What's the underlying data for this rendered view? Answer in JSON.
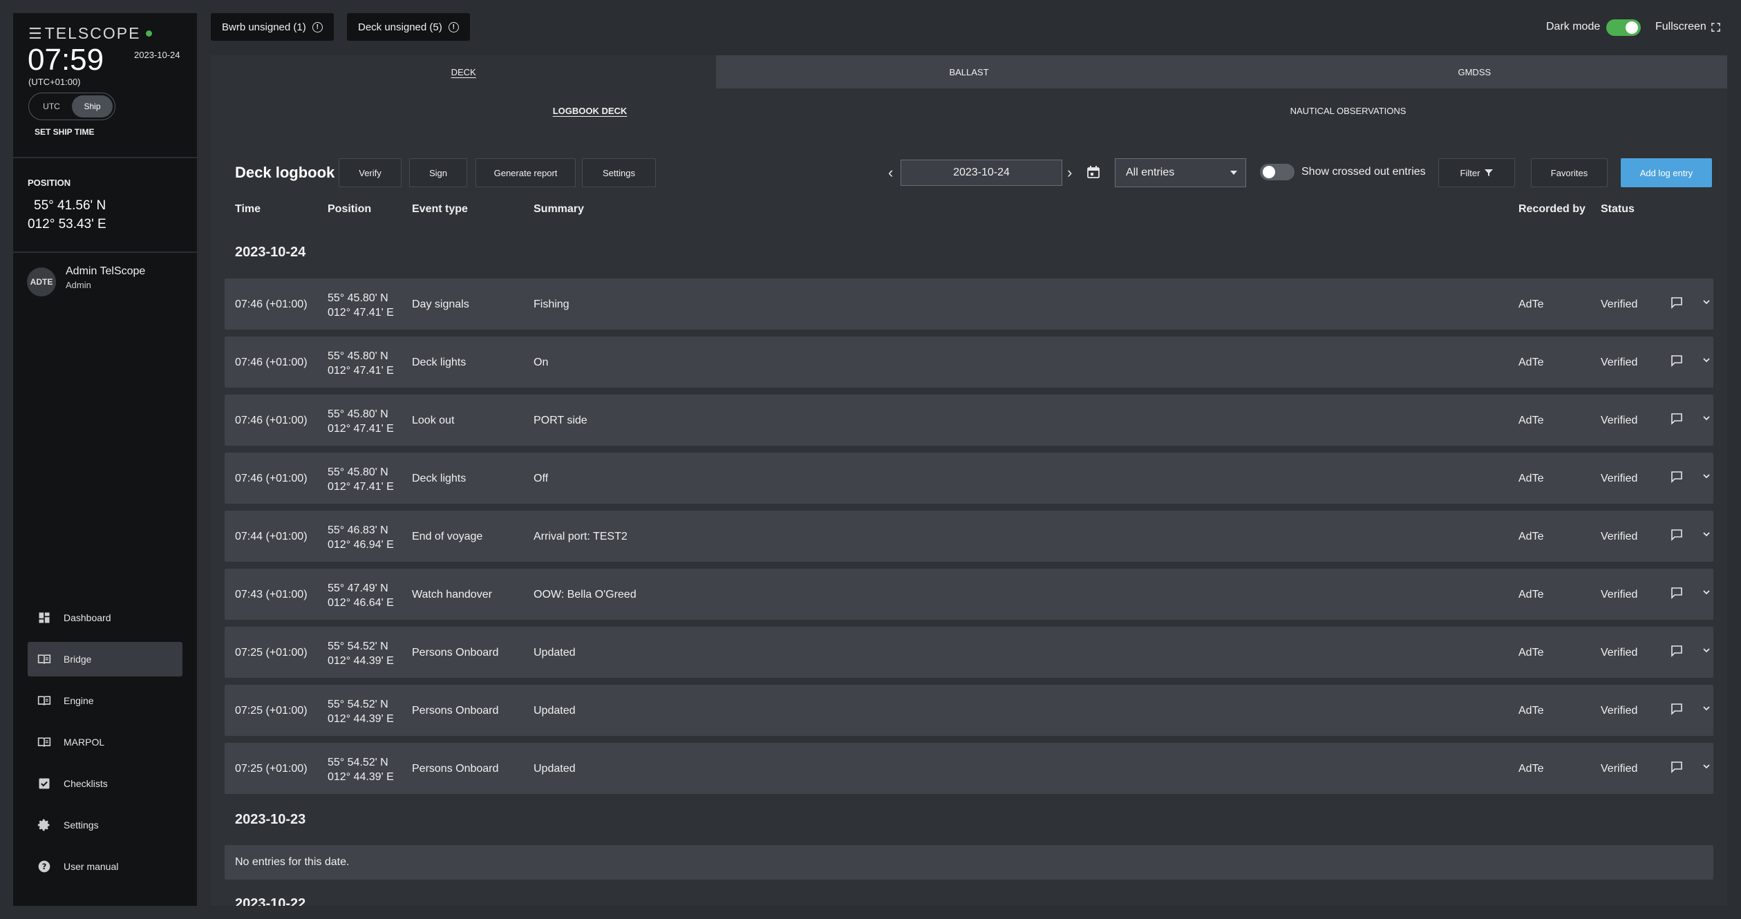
{
  "sidebar": {
    "logo_text": "TELSCOPE",
    "clock_time": "07:59",
    "clock_date": "2023-10-24",
    "timezone": "(UTC+01:00)",
    "time_modes": [
      "UTC",
      "Ship"
    ],
    "active_time_mode": "Ship",
    "set_ship_time_label": "SET SHIP TIME",
    "position_label": "POSITION",
    "position_lat": "55° 41.56' N",
    "position_lon": "012° 53.43' E",
    "user_initials": "ADTE",
    "user_name": "Admin TelScope",
    "user_role": "Admin",
    "nav": [
      {
        "label": "Dashboard",
        "icon": "dashboard-icon"
      },
      {
        "label": "Bridge",
        "icon": "book-icon",
        "active": true
      },
      {
        "label": "Engine",
        "icon": "book-icon"
      },
      {
        "label": "MARPOL",
        "icon": "book-icon"
      },
      {
        "label": "Checklists",
        "icon": "checkbox-icon"
      },
      {
        "label": "Settings",
        "icon": "gear-icon"
      },
      {
        "label": "User manual",
        "icon": "help-icon"
      }
    ]
  },
  "topbar": {
    "bwrb_label": "Bwrb unsigned (1)",
    "deck_label": "Deck unsigned (5)",
    "dark_mode_label": "Dark mode",
    "dark_mode_on": true,
    "fullscreen_label": "Fullscreen"
  },
  "tabs": [
    "DECK",
    "BALLAST",
    "GMDSS"
  ],
  "subtabs": [
    "LOGBOOK DECK",
    "NAUTICAL OBSERVATIONS"
  ],
  "toolbar": {
    "title": "Deck logbook",
    "verify": "Verify",
    "sign": "Sign",
    "generate_report": "Generate report",
    "settings": "Settings",
    "date": "2023-10-24",
    "entries_filter": "All entries",
    "show_crossed_label": "Show crossed out entries",
    "filter": "Filter",
    "favorites": "Favorites",
    "add_entry": "Add log entry"
  },
  "columns": {
    "time": "Time",
    "position": "Position",
    "event_type": "Event type",
    "summary": "Summary",
    "recorded_by": "Recorded by",
    "status": "Status"
  },
  "groups": [
    {
      "date": "2023-10-24",
      "entries": [
        {
          "time": "07:46 (+01:00)",
          "lat": "55° 45.80' N",
          "lon": "012° 47.41' E",
          "event": "Day signals",
          "summary": "Fishing",
          "recorded_by": "AdTe",
          "status": "Verified"
        },
        {
          "time": "07:46 (+01:00)",
          "lat": "55° 45.80' N",
          "lon": "012° 47.41' E",
          "event": "Deck lights",
          "summary": "On",
          "recorded_by": "AdTe",
          "status": "Verified"
        },
        {
          "time": "07:46 (+01:00)",
          "lat": "55° 45.80' N",
          "lon": "012° 47.41' E",
          "event": "Look out",
          "summary": "PORT side",
          "recorded_by": "AdTe",
          "status": "Verified"
        },
        {
          "time": "07:46 (+01:00)",
          "lat": "55° 45.80' N",
          "lon": "012° 47.41' E",
          "event": "Deck lights",
          "summary": "Off",
          "recorded_by": "AdTe",
          "status": "Verified"
        },
        {
          "time": "07:44 (+01:00)",
          "lat": "55° 46.83' N",
          "lon": "012° 46.94' E",
          "event": "End of voyage",
          "summary": "Arrival port: TEST2",
          "recorded_by": "AdTe",
          "status": "Verified"
        },
        {
          "time": "07:43 (+01:00)",
          "lat": "55° 47.49' N",
          "lon": "012° 46.64' E",
          "event": "Watch handover",
          "summary": "OOW: Bella O'Greed",
          "recorded_by": "AdTe",
          "status": "Verified"
        },
        {
          "time": "07:25 (+01:00)",
          "lat": "55° 54.52' N",
          "lon": "012° 44.39' E",
          "event": "Persons Onboard",
          "summary": "Updated",
          "recorded_by": "AdTe",
          "status": "Verified"
        },
        {
          "time": "07:25 (+01:00)",
          "lat": "55° 54.52' N",
          "lon": "012° 44.39' E",
          "event": "Persons Onboard",
          "summary": "Updated",
          "recorded_by": "AdTe",
          "status": "Verified"
        },
        {
          "time": "07:25 (+01:00)",
          "lat": "55° 54.52' N",
          "lon": "012° 44.39' E",
          "event": "Persons Onboard",
          "summary": "Updated",
          "recorded_by": "AdTe",
          "status": "Verified"
        }
      ]
    },
    {
      "date": "2023-10-23",
      "empty_text": "No entries for this date."
    },
    {
      "date": "2023-10-22"
    }
  ]
}
